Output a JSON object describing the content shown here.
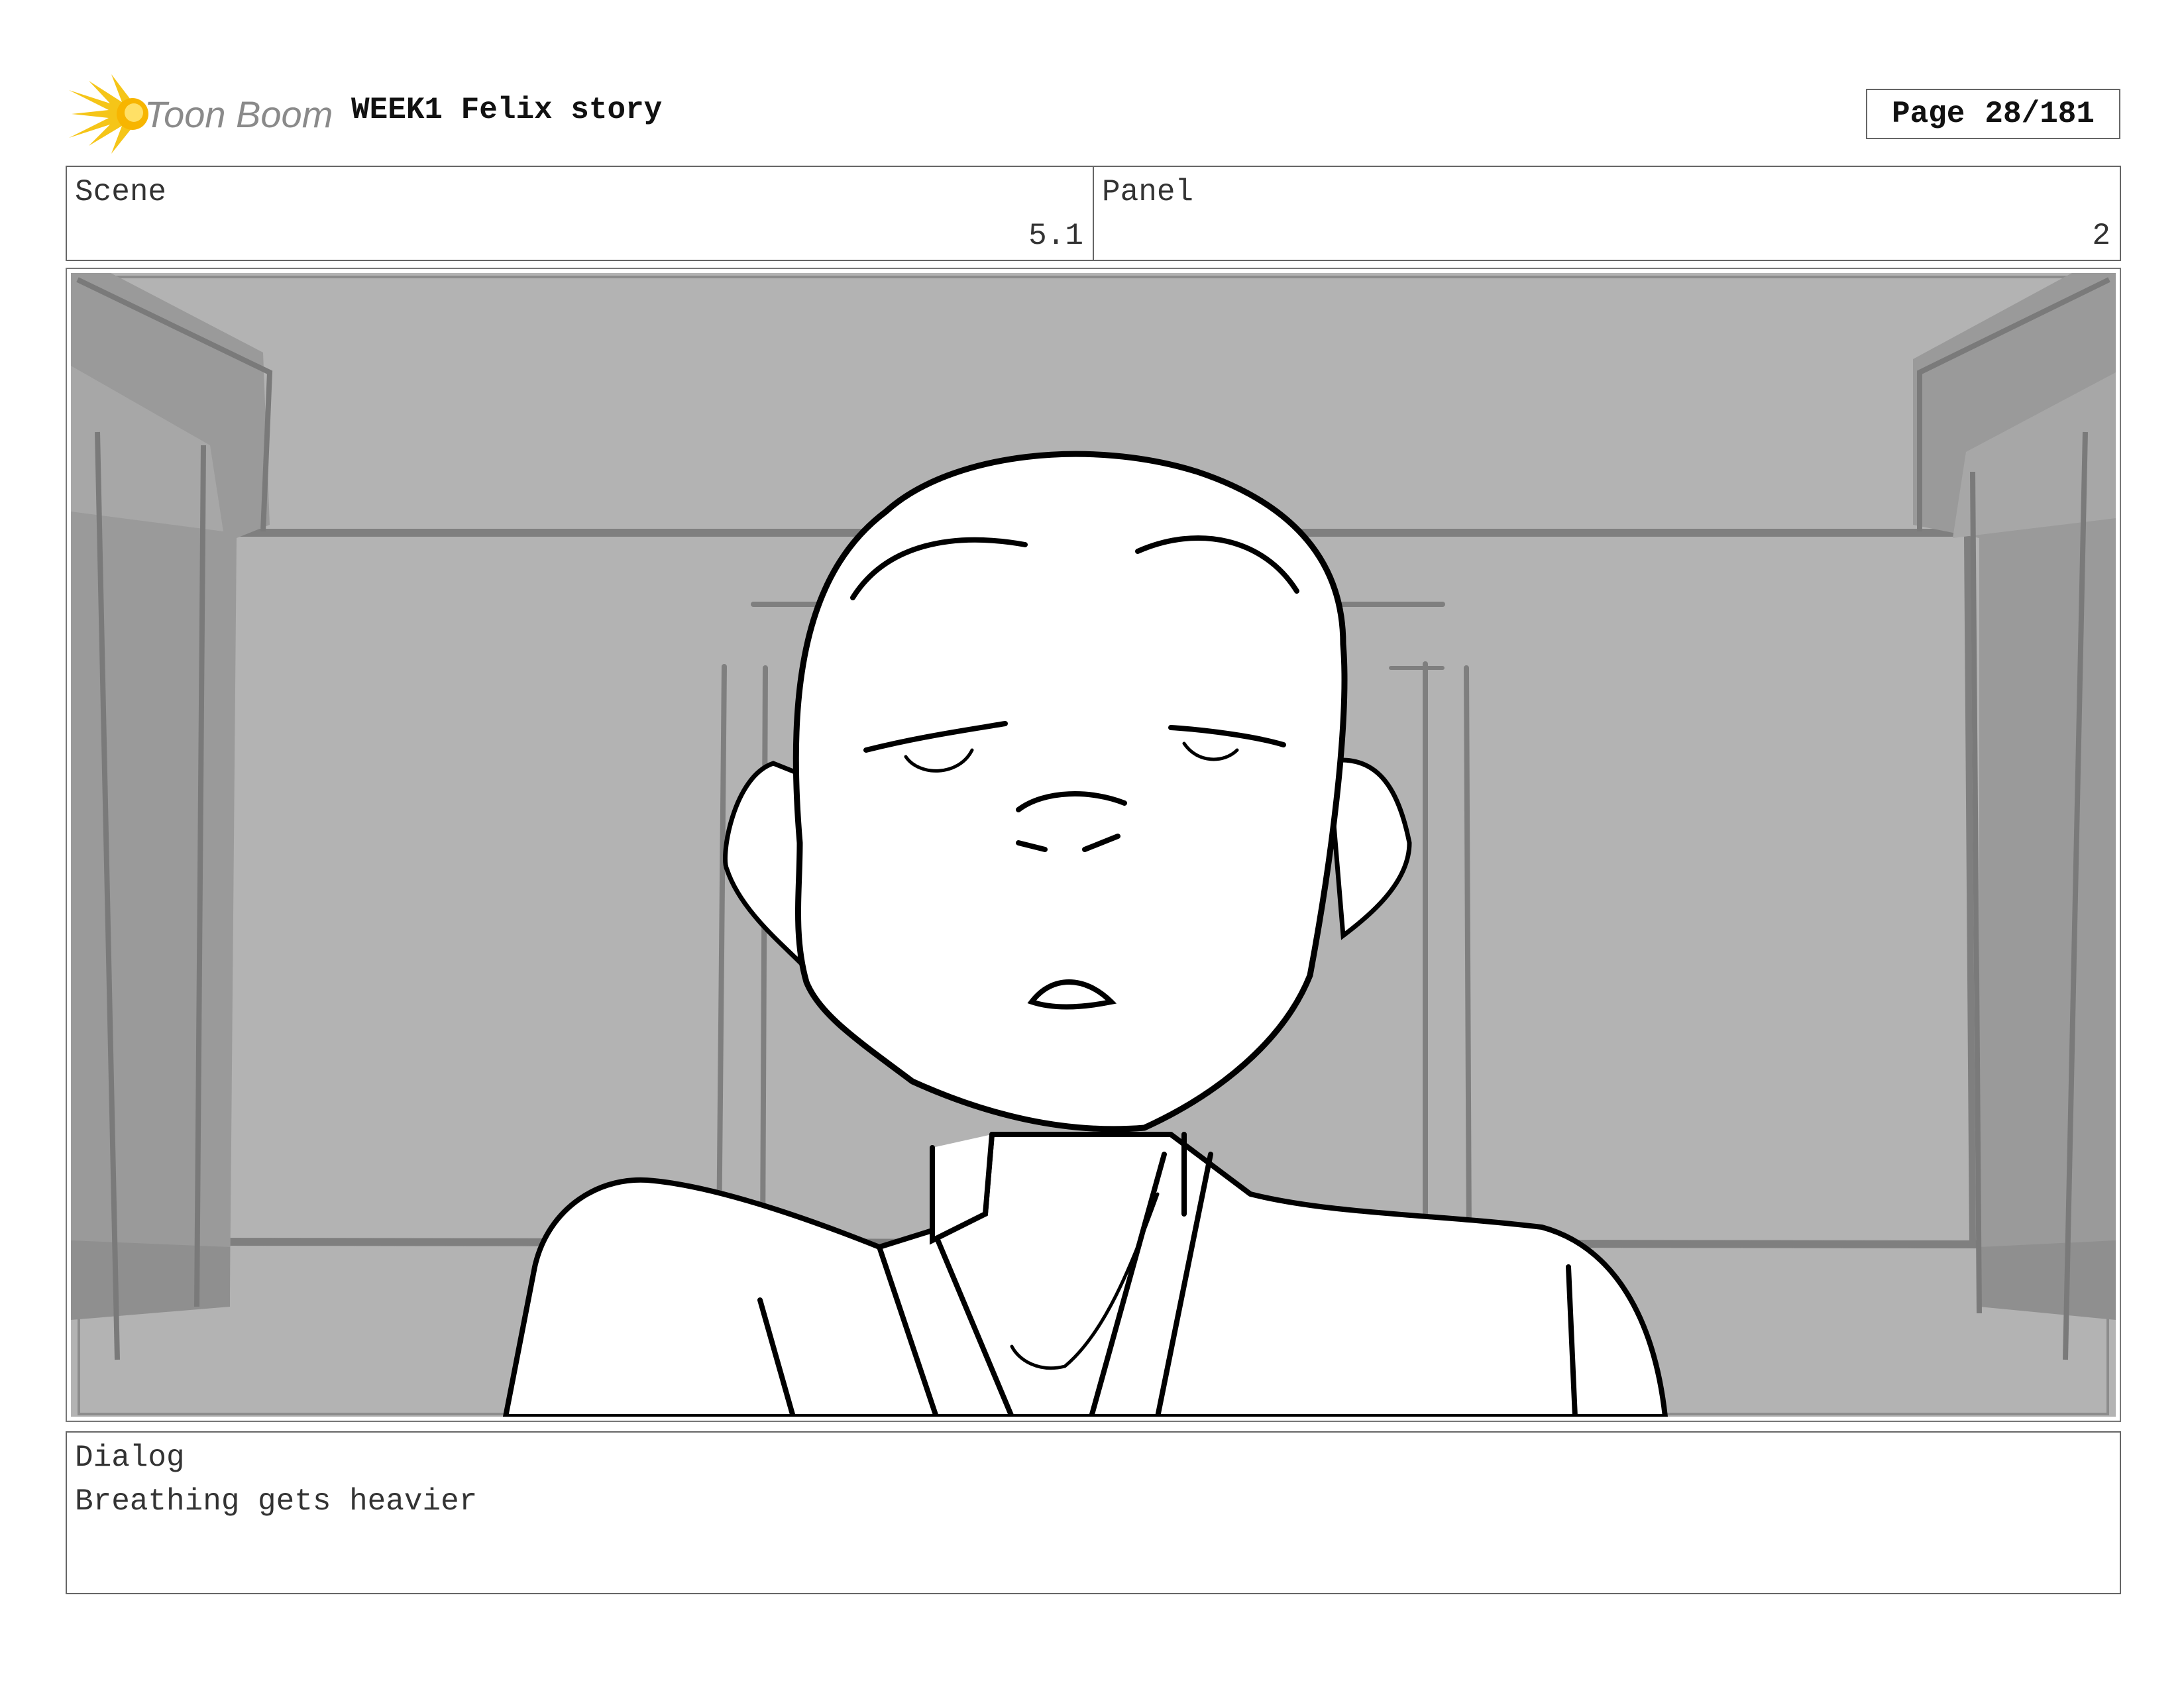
{
  "header": {
    "logo_text": "Toon Boom",
    "title": "WEEK1 Felix story",
    "page_label": "Page",
    "page_value": "28/181"
  },
  "info": {
    "scene_label": "Scene",
    "scene_value": "5.1",
    "panel_label": "Panel",
    "panel_value": "2"
  },
  "dialog": {
    "label": "Dialog",
    "text": "Breathing gets heavier"
  },
  "colors": {
    "logo_yellow": "#F5C518",
    "logo_text_gray": "#8a8a8a",
    "background_gray": "#b3b3b3",
    "pillar_gray": "#9a9a9a",
    "shadow_gray": "#a7a7a7"
  }
}
